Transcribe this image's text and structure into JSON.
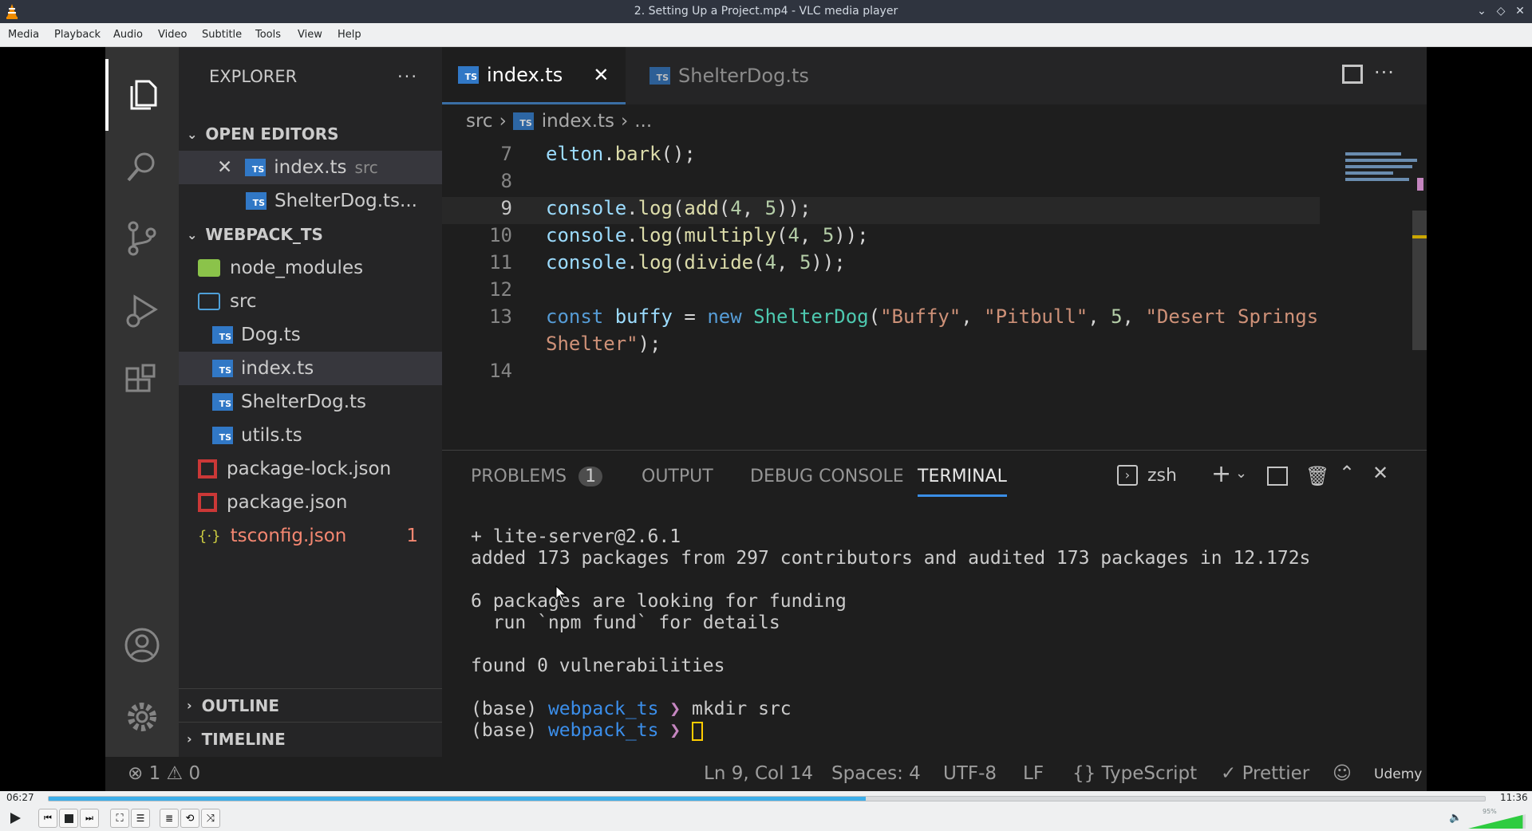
{
  "window": {
    "title": "2. Setting Up a Project.mp4 - VLC media player",
    "controls": [
      "minimize",
      "maximize",
      "close"
    ]
  },
  "menu": [
    "Media",
    "Playback",
    "Audio",
    "Video",
    "Subtitle",
    "Tools",
    "View",
    "Help"
  ],
  "vscode": {
    "explorer_title": "EXPLORER",
    "open_editors_label": "OPEN EDITORS",
    "open_editors": [
      {
        "name": "index.ts",
        "path": "src"
      },
      {
        "name": "ShelterDog.ts..."
      }
    ],
    "project_label": "WEBPACK_TS",
    "tree": {
      "node_modules": "node_modules",
      "src": "src",
      "src_files": [
        "Dog.ts",
        "index.ts",
        "ShelterDog.ts",
        "utils.ts"
      ],
      "package_lock": "package-lock.json",
      "package": "package.json",
      "tsconfig": "tsconfig.json",
      "tsconfig_errors": "1"
    },
    "outline_label": "OUTLINE",
    "timeline_label": "TIMELINE",
    "tabs": [
      {
        "label": "index.ts",
        "active": true
      },
      {
        "label": "ShelterDog.ts",
        "active": false
      }
    ],
    "breadcrumb": {
      "folder": "src",
      "file": "index.ts",
      "rest": "..."
    },
    "ts_badge": "TS",
    "line_numbers": [
      "7",
      "8",
      "9",
      "10",
      "11",
      "12",
      "13",
      "",
      "14"
    ],
    "panel_tabs": {
      "problems": "PROBLEMS",
      "problems_count": "1",
      "output": "OUTPUT",
      "debug_console": "DEBUG CONSOLE",
      "terminal": "TERMINAL"
    },
    "shell": "zsh",
    "terminal_lines": [
      "+ lite-server@2.6.1",
      "added 173 packages from 297 contributors and audited 173 packages in 12.172s",
      "",
      "6 packages are looking for funding",
      "  run `npm fund` for details",
      "",
      "found 0 vulnerabilities",
      ""
    ],
    "prompt": {
      "env": "(base)",
      "dir": "webpack_ts",
      "arrow": "❯",
      "command": "mkdir src"
    },
    "status": {
      "errors": "1",
      "warnings": "0",
      "position": "Ln 9, Col 14",
      "spaces": "Spaces: 4",
      "encoding": "UTF-8",
      "eol": "LF",
      "language": "TypeScript",
      "formatter": "Prettier",
      "watermark": "Udemy"
    }
  },
  "player": {
    "elapsed": "06:27",
    "total": "11:36",
    "progress_fraction": 0.569,
    "volume_percent": "95%",
    "volume_fraction": 0.95
  },
  "colors": {
    "accent_blue": "#3178c6",
    "vlc_seek": "#3daee9",
    "volume_green": "#2ecc40"
  }
}
